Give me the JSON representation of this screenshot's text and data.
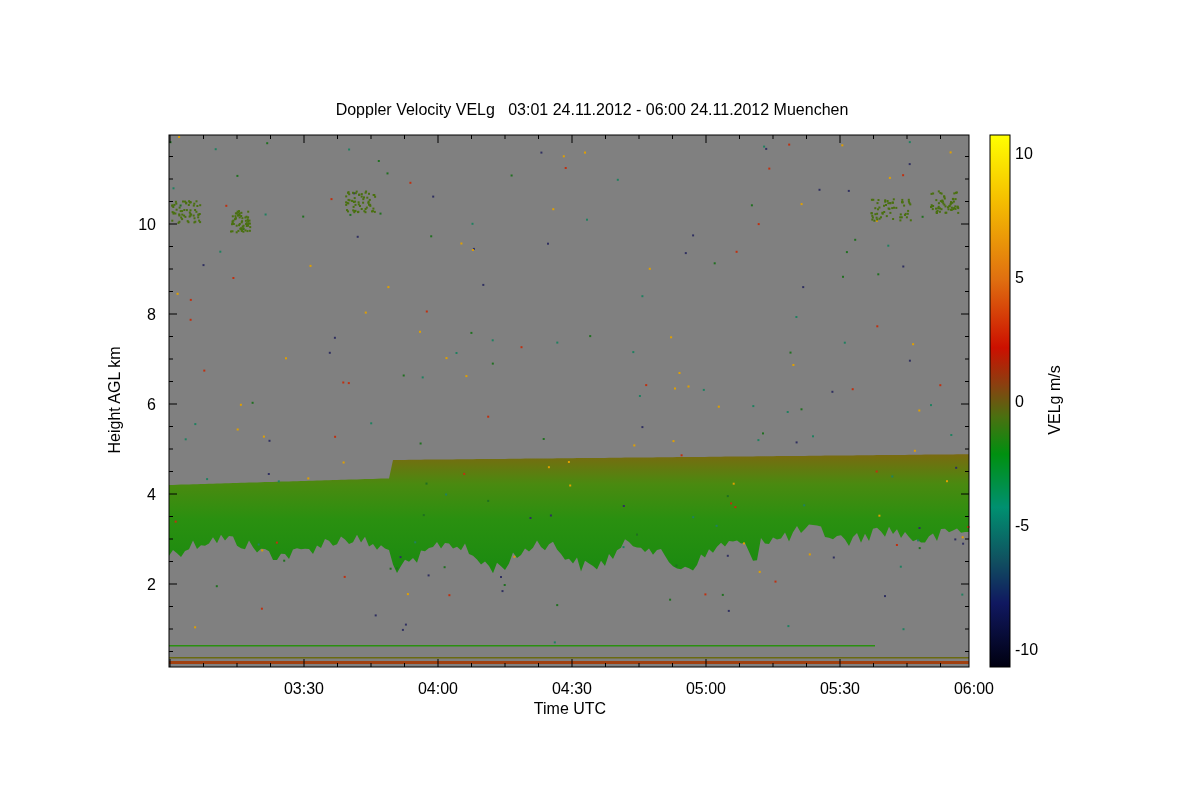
{
  "title": "Doppler Velocity VELg   03:01 24.11.2012 - 06:00 24.11.2012 Muenchen",
  "x_axis": {
    "label": "Time UTC",
    "ticks": [
      "03:30",
      "04:00",
      "04:30",
      "05:00",
      "05:30",
      "06:00"
    ]
  },
  "y_axis": {
    "label": "Height AGL km",
    "ticks": [
      "10",
      "8",
      "6",
      "4",
      "2"
    ]
  },
  "colorbar": {
    "label": "VELg m/s",
    "ticks": [
      "10",
      "5",
      "0",
      "-5",
      "-10"
    ]
  }
}
